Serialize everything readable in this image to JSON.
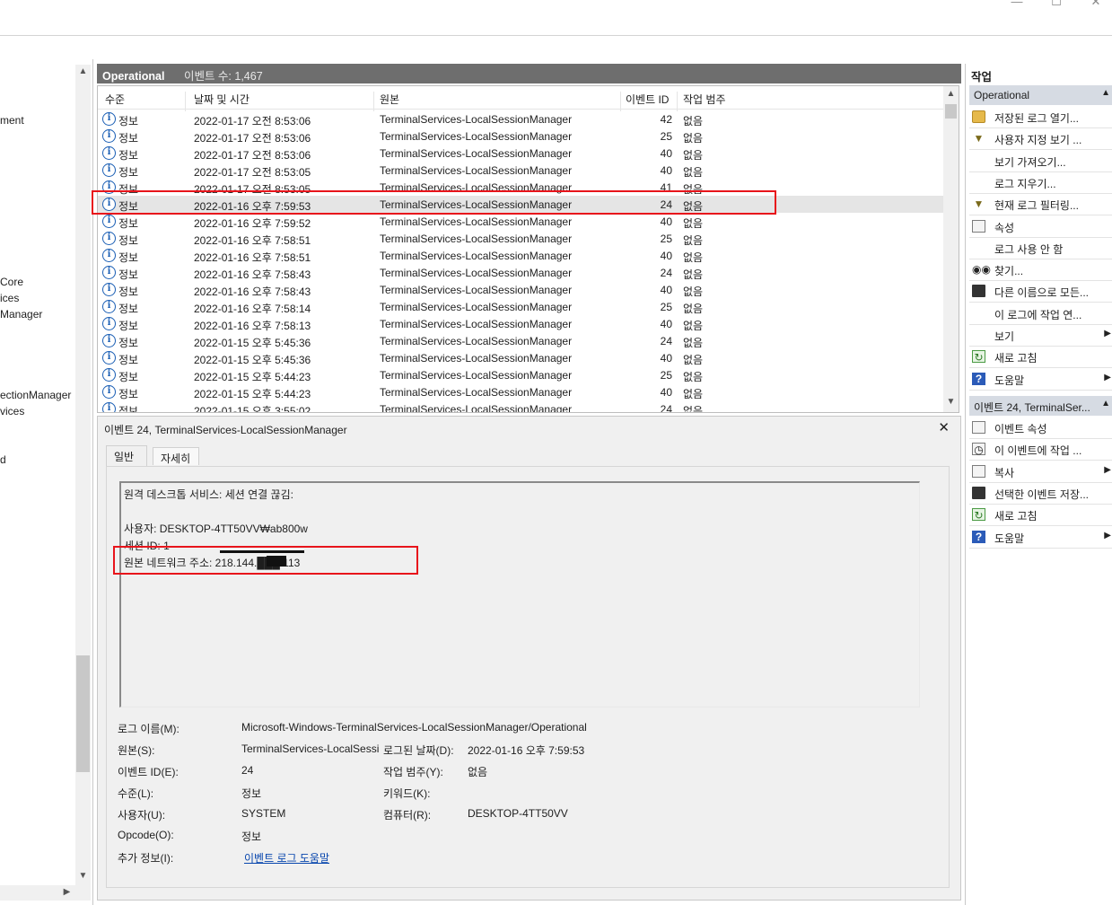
{
  "window": {
    "minimize": "—",
    "maximize": "☐",
    "close": "✕"
  },
  "tree": {
    "items": [
      "ment",
      "Core",
      "ices",
      "Manager",
      "ectionManager",
      "vices",
      "d"
    ]
  },
  "center": {
    "log_name": "Operational",
    "event_count": "이벤트 수: 1,467"
  },
  "list": {
    "columns": [
      "수준",
      "날짜 및 시간",
      "원본",
      "이벤트 ID",
      "작업 범주"
    ],
    "rows": [
      {
        "level": "정보",
        "date": "2022-01-17 오전 8:53:06",
        "source": "TerminalServices-LocalSessionManager",
        "id": "42",
        "category": "없음"
      },
      {
        "level": "정보",
        "date": "2022-01-17 오전 8:53:06",
        "source": "TerminalServices-LocalSessionManager",
        "id": "25",
        "category": "없음"
      },
      {
        "level": "정보",
        "date": "2022-01-17 오전 8:53:06",
        "source": "TerminalServices-LocalSessionManager",
        "id": "40",
        "category": "없음"
      },
      {
        "level": "정보",
        "date": "2022-01-17 오전 8:53:05",
        "source": "TerminalServices-LocalSessionManager",
        "id": "40",
        "category": "없음"
      },
      {
        "level": "정보",
        "date": "2022-01-17 오전 8:53:05",
        "source": "TerminalServices-LocalSessionManager",
        "id": "41",
        "category": "없음"
      },
      {
        "level": "정보",
        "date": "2022-01-16 오후 7:59:53",
        "source": "TerminalServices-LocalSessionManager",
        "id": "24",
        "category": "없음"
      },
      {
        "level": "정보",
        "date": "2022-01-16 오후 7:59:52",
        "source": "TerminalServices-LocalSessionManager",
        "id": "40",
        "category": "없음"
      },
      {
        "level": "정보",
        "date": "2022-01-16 오후 7:58:51",
        "source": "TerminalServices-LocalSessionManager",
        "id": "25",
        "category": "없음"
      },
      {
        "level": "정보",
        "date": "2022-01-16 오후 7:58:51",
        "source": "TerminalServices-LocalSessionManager",
        "id": "40",
        "category": "없음"
      },
      {
        "level": "정보",
        "date": "2022-01-16 오후 7:58:43",
        "source": "TerminalServices-LocalSessionManager",
        "id": "24",
        "category": "없음"
      },
      {
        "level": "정보",
        "date": "2022-01-16 오후 7:58:43",
        "source": "TerminalServices-LocalSessionManager",
        "id": "40",
        "category": "없음"
      },
      {
        "level": "정보",
        "date": "2022-01-16 오후 7:58:14",
        "source": "TerminalServices-LocalSessionManager",
        "id": "25",
        "category": "없음"
      },
      {
        "level": "정보",
        "date": "2022-01-16 오후 7:58:13",
        "source": "TerminalServices-LocalSessionManager",
        "id": "40",
        "category": "없음"
      },
      {
        "level": "정보",
        "date": "2022-01-15 오후 5:45:36",
        "source": "TerminalServices-LocalSessionManager",
        "id": "24",
        "category": "없음"
      },
      {
        "level": "정보",
        "date": "2022-01-15 오후 5:45:36",
        "source": "TerminalServices-LocalSessionManager",
        "id": "40",
        "category": "없음"
      },
      {
        "level": "정보",
        "date": "2022-01-15 오후 5:44:23",
        "source": "TerminalServices-LocalSessionManager",
        "id": "25",
        "category": "없음"
      },
      {
        "level": "정보",
        "date": "2022-01-15 오후 5:44:23",
        "source": "TerminalServices-LocalSessionManager",
        "id": "40",
        "category": "없음"
      },
      {
        "level": "정보",
        "date": "2022-01-15 오후 3:55:02",
        "source": "TerminalServices-LocalSessionManager",
        "id": "24",
        "category": "없음"
      }
    ],
    "selected_index": 5
  },
  "detail": {
    "title": "이벤트 24, TerminalServices-LocalSessionManager",
    "close": "✕",
    "tabs": [
      "일반",
      "자세히"
    ],
    "message": {
      "line1": "원격 데스크톱 서비스: 세션 연결 끊김:",
      "user": "사용자: DESKTOP-4TT50VV₩ab800w",
      "session": "세션 ID: 1",
      "address": "원본 네트워크 주소: 218.144.███.113"
    },
    "props": {
      "log_name_label": "로그 이름(M):",
      "log_name": "Microsoft-Windows-TerminalServices-LocalSessionManager/Operational",
      "source_label": "원본(S):",
      "source": "TerminalServices-LocalSessi",
      "logged_label": "로그된 날짜(D):",
      "logged": "2022-01-16 오후 7:59:53",
      "event_id_label": "이벤트 ID(E):",
      "event_id": "24",
      "task_label": "작업 범주(Y):",
      "task": "없음",
      "level_label": "수준(L):",
      "level": "정보",
      "keywords_label": "키워드(K):",
      "user_label": "사용자(U):",
      "user": "SYSTEM",
      "computer_label": "컴퓨터(R):",
      "computer": "DESKTOP-4TT50VV",
      "opcode_label": "Opcode(O):",
      "opcode": "정보",
      "more_label": "추가 정보(I):",
      "more_link": "이벤트 로그 도움말"
    }
  },
  "actions": {
    "title": "작업",
    "section1": "Operational",
    "items1": [
      {
        "icon": "folder-open-icon",
        "label": "저장된 로그 열기...",
        "sub": false
      },
      {
        "icon": "filter-icon",
        "label": "사용자 지정 보기 ...",
        "sub": false
      },
      {
        "icon": "",
        "label": "보기 가져오기...",
        "sub": false
      },
      {
        "icon": "",
        "label": "로그 지우기...",
        "sub": false
      },
      {
        "icon": "filter-icon",
        "label": "현재 로그 필터링...",
        "sub": false
      },
      {
        "icon": "properties-icon",
        "label": "속성",
        "sub": false
      },
      {
        "icon": "",
        "label": "로그 사용 안 함",
        "sub": false
      },
      {
        "icon": "binoculars-icon",
        "label": "찾기...",
        "sub": false
      },
      {
        "icon": "save-icon",
        "label": "다른 이름으로 모든...",
        "sub": false
      },
      {
        "icon": "",
        "label": "이 로그에 작업 연...",
        "sub": false
      },
      {
        "icon": "",
        "label": "보기",
        "sub": true
      },
      {
        "icon": "refresh-icon",
        "label": "새로 고침",
        "sub": false
      },
      {
        "icon": "help-icon",
        "label": "도움말",
        "sub": true
      }
    ],
    "section2": "이벤트 24, TerminalSer...",
    "items2": [
      {
        "icon": "properties-icon",
        "label": "이벤트 속성",
        "sub": false
      },
      {
        "icon": "task-icon",
        "label": "이 이벤트에 작업 ...",
        "sub": false
      },
      {
        "icon": "copy-icon",
        "label": "복사",
        "sub": true
      },
      {
        "icon": "save-icon",
        "label": "선택한 이벤트 저장...",
        "sub": false
      },
      {
        "icon": "refresh-icon",
        "label": "새로 고침",
        "sub": false
      },
      {
        "icon": "help-icon",
        "label": "도움말",
        "sub": true
      }
    ]
  },
  "colors": {
    "highlight": "#e8141b",
    "header_bg": "#6e6e6e",
    "section_bg": "#d6dbe3",
    "info_icon": "#1b5fb5"
  }
}
